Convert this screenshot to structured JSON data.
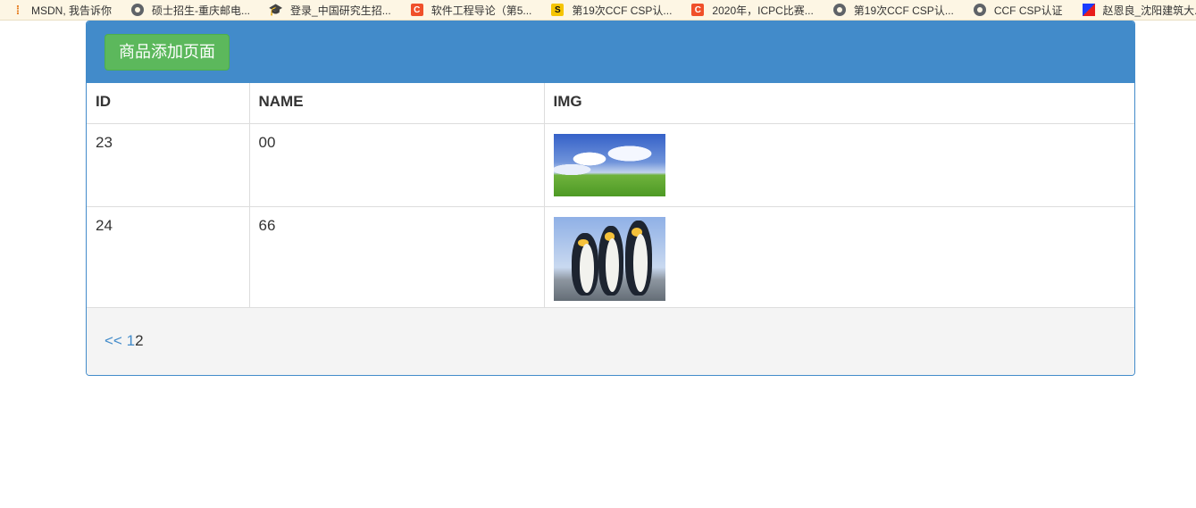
{
  "bookmarks": [
    {
      "icon": "apps-icon",
      "label": "MSDN, 我告诉你"
    },
    {
      "icon": "globe-icon",
      "label": "硕士招生-重庆邮电..."
    },
    {
      "icon": "graduation-cap-icon",
      "label": "登录_中国研究生招..."
    },
    {
      "icon": "csdn-icon",
      "label": "软件工程导论（第5..."
    },
    {
      "icon": "s-logo-icon",
      "label": "第19次CCF CSP认..."
    },
    {
      "icon": "csdn-icon",
      "label": "2020年，ICPC比赛..."
    },
    {
      "icon": "globe-icon",
      "label": "第19次CCF CSP认..."
    },
    {
      "icon": "globe-icon",
      "label": "CCF CSP认证"
    },
    {
      "icon": "z-logo-icon",
      "label": "赵恩良_沈阳建筑大..."
    }
  ],
  "panel": {
    "add_button": "商品添加页面",
    "columns": [
      "ID",
      "NAME",
      "IMG"
    ],
    "rows": [
      {
        "id": "23",
        "name": "00",
        "img": "landscape-thumbnail"
      },
      {
        "id": "24",
        "name": "66",
        "img": "penguins-thumbnail"
      }
    ],
    "pager": {
      "prev": "<<",
      "page1": "1",
      "page2": "2"
    }
  },
  "colors": {
    "primary": "#428bca",
    "success": "#5cb85c",
    "footer_bg": "#f4f4f4",
    "bookmark_bar": "#fdf6e4"
  }
}
